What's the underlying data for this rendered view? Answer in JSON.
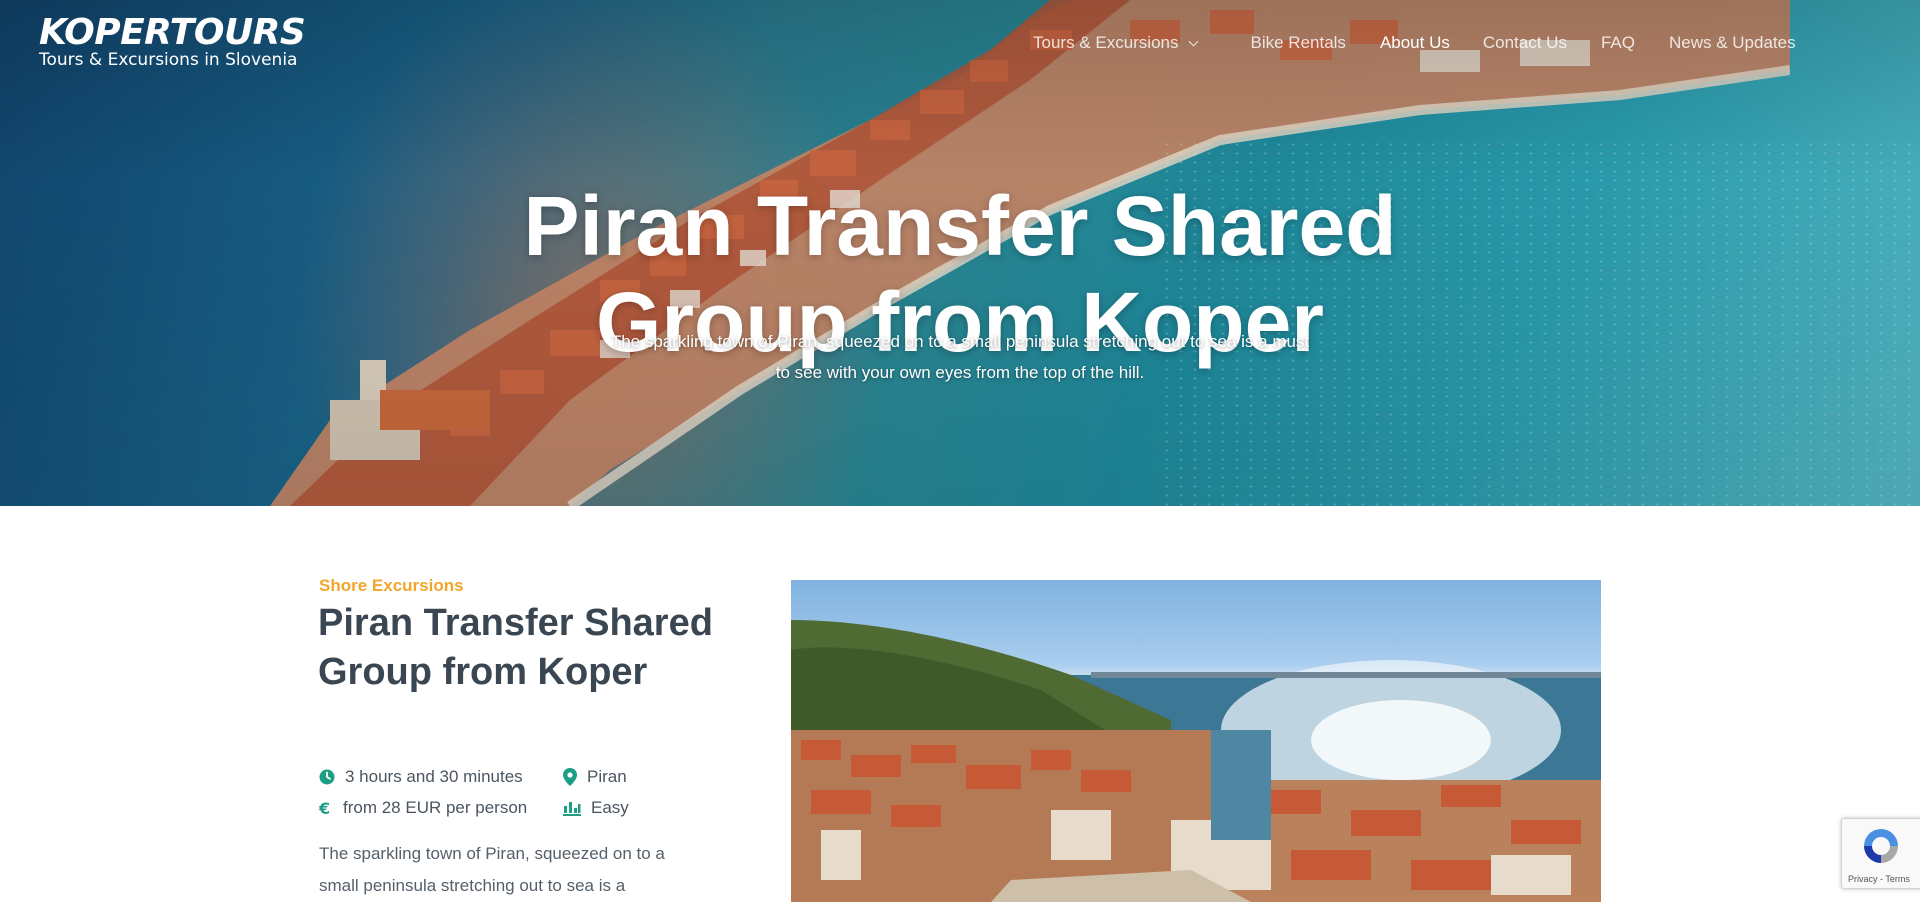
{
  "brand": {
    "logo": "KOPERTOURS",
    "tagline": "Tours & Excursions in Slovenia"
  },
  "nav": {
    "items": [
      {
        "label": "Tours & Excursions",
        "has_dropdown": true
      },
      {
        "label": "Bike Rentals"
      },
      {
        "label": "About Us",
        "active": true
      },
      {
        "label": "Contact Us"
      },
      {
        "label": "FAQ"
      },
      {
        "label": "News & Updates"
      }
    ]
  },
  "hero": {
    "title": "Piran Transfer Shared Group from Koper",
    "subtitle": "The sparkling town of Piran, squeezed on to a small peninsula stretching out to sea is a must to see with your own eyes from the top of the hill."
  },
  "tour": {
    "category": "Shore Excursions",
    "title": "Piran Transfer Shared Group from Koper",
    "duration": "3 hours and 30 minutes",
    "location": "Piran",
    "price": "from 28 EUR per person",
    "difficulty": "Easy",
    "description": "The sparkling town of Piran, squeezed on to a small peninsula stretching out to sea is a"
  },
  "recaptcha": {
    "links": "Privacy - Terms"
  },
  "colors": {
    "accent": "#f3a52c",
    "icon": "#1f9e86",
    "heading": "#3a4651"
  }
}
